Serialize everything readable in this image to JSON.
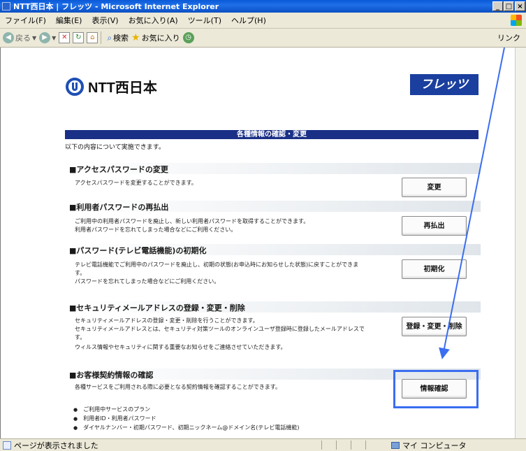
{
  "window": {
    "title": "NTT西日本 | フレッツ - Microsoft Internet Explorer",
    "buttons": [
      "_",
      "□",
      "×"
    ]
  },
  "menubar": [
    "ファイル(F)",
    "編集(E)",
    "表示(V)",
    "お気に入り(A)",
    "ツール(T)",
    "ヘルプ(H)"
  ],
  "toolbar": {
    "back": "戻る",
    "search": "検索",
    "favorites": "お気に入り",
    "links": "リンク"
  },
  "page": {
    "logo_left": "NTT西日本",
    "logo_right": "フレッツ",
    "heading": "各種情報の確認・変更",
    "intro": "以下の内容について実施できます。",
    "sections": [
      {
        "title": "■アクセスパスワードの変更",
        "lines": [
          "アクセスパスワードを変更することができます。"
        ],
        "button": "変更"
      },
      {
        "title": "■利用者パスワードの再払出",
        "lines": [
          "ご利用中の利用者パスワードを廃止し、新しい利用者パスワードを取得することができます。",
          "利用者パスワードを忘れてしまった場合などにご利用ください。"
        ],
        "button": "再払出"
      },
      {
        "title": "■パスワード(テレビ電話機能)の初期化",
        "lines": [
          "テレビ電話機能でご利用中のパスワードを廃止し、初期の状態(お申込時にお知らせした状態)に戻すことができま",
          "す。",
          "パスワードを忘れてしまった場合などにご利用ください。"
        ],
        "button": "初期化"
      },
      {
        "title": "■セキュリティメールアドレスの登録・変更・削除",
        "lines": [
          "セキュリティメールアドレスの登録・変更・削除を行うことができます。",
          "セキュリティメールアドレスとは、セキュリティ対策ツールのオンラインユーザ登録時に登録したメールアドレスで",
          "す。",
          "ウィルス情報やセキュリティに関する重要なお知らせをご連絡させていただきます。"
        ],
        "button": "登録・変更・削除"
      },
      {
        "title": "■お客様契約情報の確認",
        "lines": [
          "各種サービスをご利用される際に必要となる契約情報を確認することができます。"
        ],
        "button": "情報確認"
      }
    ],
    "bullets": [
      "ご利用中サービスのプラン",
      "利用者ID・利用者パスワード",
      "ダイヤルナンバー・初期パスワード、初期ニックネーム@ドメイン名(テレビ電話機能)"
    ]
  },
  "status": {
    "text": "ページが表示されました",
    "zone": "マイ コンピュータ"
  },
  "colors": {
    "heading_bar": "#1a2f86",
    "highlight": "#3a6df0"
  }
}
